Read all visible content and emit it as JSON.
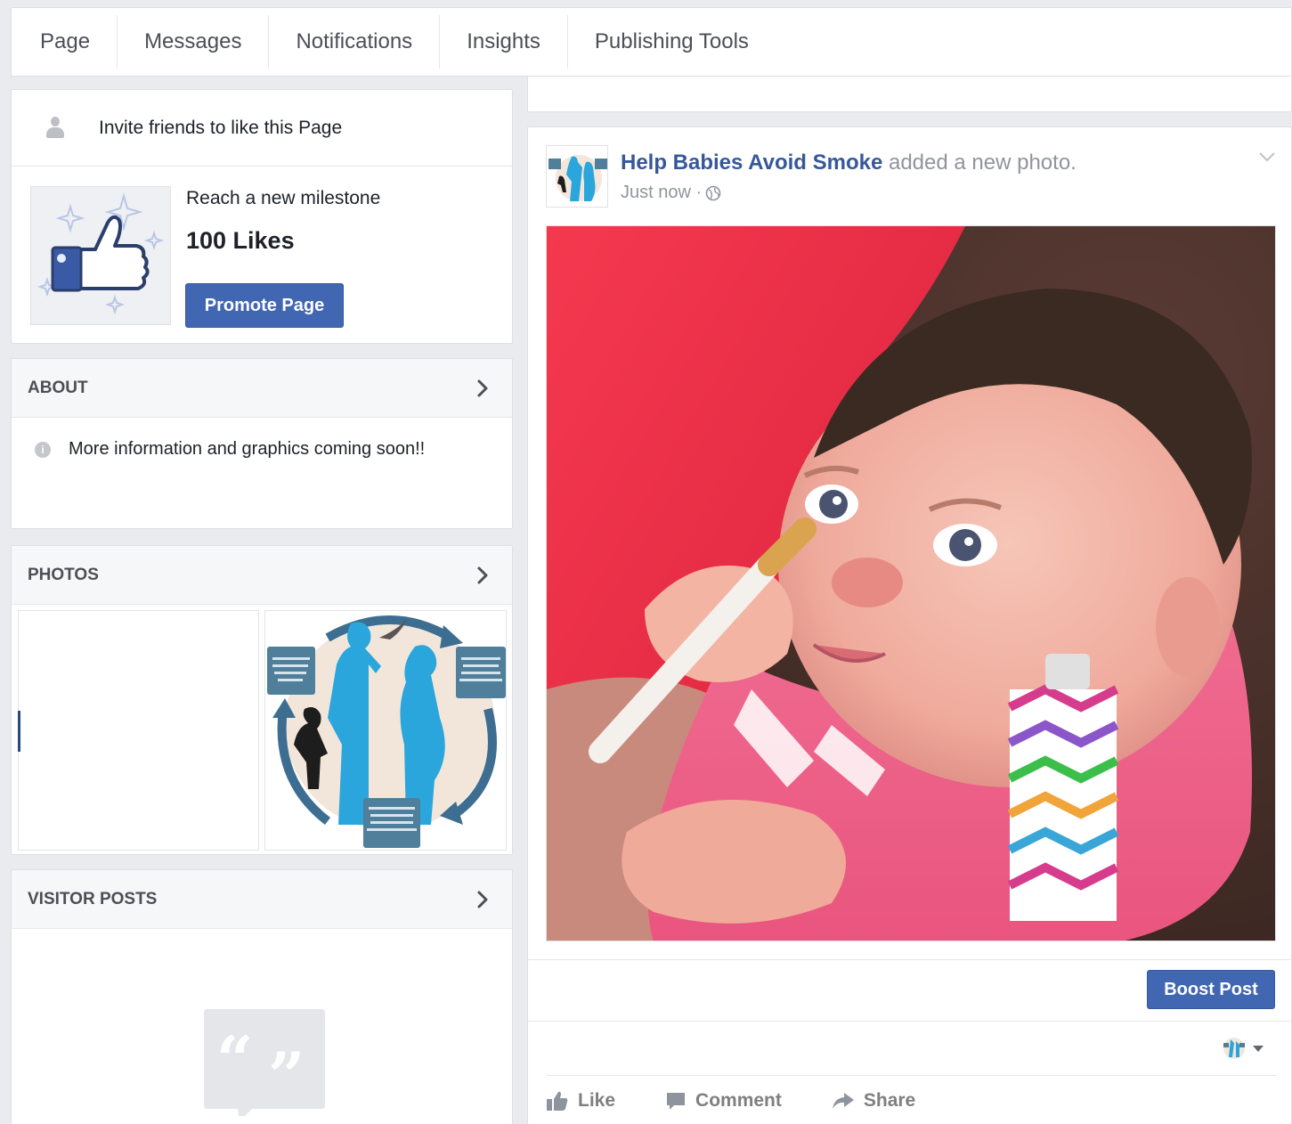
{
  "topnav": {
    "tabs": [
      {
        "label": "Page"
      },
      {
        "label": "Messages"
      },
      {
        "label": "Notifications"
      },
      {
        "label": "Insights"
      },
      {
        "label": "Publishing Tools"
      }
    ]
  },
  "sidebar": {
    "invite": {
      "label": "Invite friends to like this Page",
      "icon": "add-person-icon"
    },
    "milestone": {
      "title": "Reach a new milestone",
      "value": "100 Likes",
      "button_label": "Promote Page",
      "icon": "thumbs-up-sparkle-icon"
    },
    "about": {
      "title": "ABOUT",
      "text": "More information and graphics coming soon!!",
      "icon": "info-icon"
    },
    "photos": {
      "title": "PHOTOS"
    },
    "visitor_posts": {
      "title": "VISITOR POSTS",
      "icon": "quote-icon"
    }
  },
  "post": {
    "page_name": "Help Babies Avoid Smoke",
    "action_text": "added a new photo.",
    "time": "Just now ·",
    "privacy_icon": "globe-icon",
    "boost_label": "Boost Post",
    "actions": [
      {
        "label": "Like",
        "icon": "thumbs-up-icon"
      },
      {
        "label": "Comment",
        "icon": "comment-icon"
      },
      {
        "label": "Share",
        "icon": "share-arrow-icon"
      }
    ]
  },
  "colors": {
    "brand_blue": "#4267b2",
    "link_blue": "#365899",
    "background": "#e9ebee",
    "infographic_blue": "#2aa6dc"
  }
}
